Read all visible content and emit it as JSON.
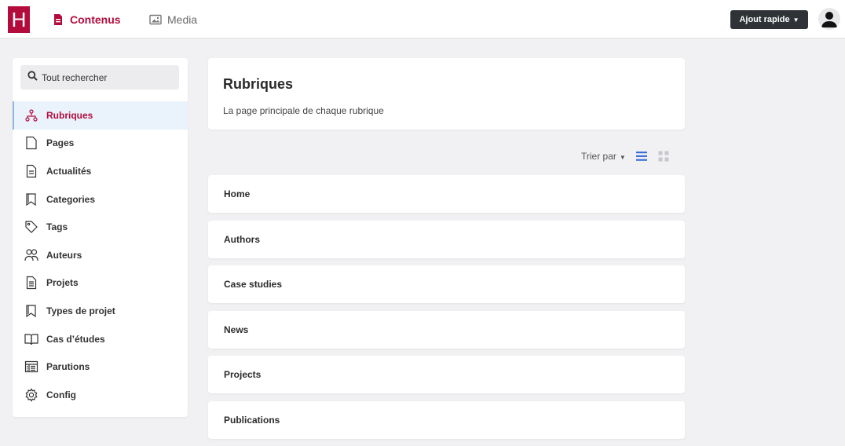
{
  "topbar": {
    "logo_text": "H",
    "tabs": [
      {
        "label": "Contenus",
        "icon": "document-icon",
        "active": true
      },
      {
        "label": "Media",
        "icon": "image-icon",
        "active": false
      }
    ],
    "quick_add_label": "Ajout rapide",
    "accent_color": "#b40b3d"
  },
  "sidebar": {
    "search_placeholder": "Tout rechercher",
    "items": [
      {
        "label": "Rubriques",
        "icon": "sitemap-icon",
        "active": true
      },
      {
        "label": "Pages",
        "icon": "page-icon"
      },
      {
        "label": "Actualités",
        "icon": "news-icon"
      },
      {
        "label": "Categories",
        "icon": "bookmark-icon"
      },
      {
        "label": "Tags",
        "icon": "tag-icon"
      },
      {
        "label": "Auteurs",
        "icon": "users-icon"
      },
      {
        "label": "Projets",
        "icon": "project-file-icon"
      },
      {
        "label": "Types de projet",
        "icon": "bookmark-icon"
      },
      {
        "label": "Cas d’études",
        "icon": "book-icon"
      },
      {
        "label": "Parutions",
        "icon": "newspaper-icon"
      },
      {
        "label": "Config",
        "icon": "gear-icon"
      }
    ]
  },
  "main": {
    "title": "Rubriques",
    "subtitle": "La page principale de chaque rubrique",
    "sort_label": "Trier par",
    "rows": [
      "Home",
      "Authors",
      "Case studies",
      "News",
      "Projects",
      "Publications"
    ]
  }
}
